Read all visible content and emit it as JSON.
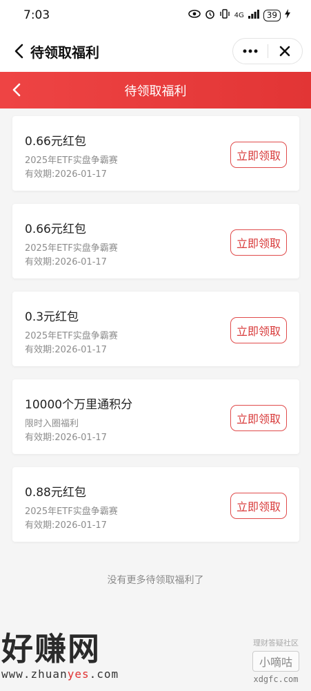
{
  "status_bar": {
    "time": "7:03",
    "network": "4G",
    "battery": "39"
  },
  "nav": {
    "title": "待领取福利"
  },
  "header": {
    "title": "待领取福利"
  },
  "cards": [
    {
      "title": "0.66元红包",
      "subtitle": "2025年ETF实盘争霸赛",
      "validity": "有效期:2026-01-17",
      "button": "立即领取"
    },
    {
      "title": "0.66元红包",
      "subtitle": "2025年ETF实盘争霸赛",
      "validity": "有效期:2026-01-17",
      "button": "立即领取"
    },
    {
      "title": "0.3元红包",
      "subtitle": "2025年ETF实盘争霸赛",
      "validity": "有效期:2026-01-17",
      "button": "立即领取"
    },
    {
      "title": "10000个万里通积分",
      "subtitle": "限时入圈福利",
      "validity": "有效期:2026-01-17",
      "button": "立即领取"
    },
    {
      "title": "0.88元红包",
      "subtitle": "2025年ETF实盘争霸赛",
      "validity": "有效期:2026-01-17",
      "button": "立即领取"
    }
  ],
  "end_tip": "没有更多待领取福利了",
  "watermark_left": {
    "brand": "好赚网",
    "url_prefix": "www.zhuan",
    "url_highlight": "yes",
    "url_suffix": ".com"
  },
  "watermark_right": {
    "tag": "理财答疑社区",
    "name": "小嘀咕",
    "url": "xdgfc.com"
  },
  "colors": {
    "accent": "#e23535",
    "button_text": "#d83a3a"
  }
}
